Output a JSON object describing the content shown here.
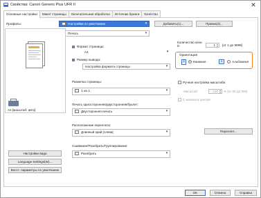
{
  "window": {
    "title": "Свойства: Canon Generic Plus UFR II",
    "close_glyph": "✕"
  },
  "tabs": [
    {
      "label": "Основные настройки"
    },
    {
      "label": "Макет страницы"
    },
    {
      "label": "Окончательная обработка"
    },
    {
      "label": "Источник бумаги"
    },
    {
      "label": "Качество"
    }
  ],
  "profile": {
    "label": "Профилы:",
    "value": "Настройки по умолчанию",
    "add_label": "Добавить(1)...",
    "edit_label": "Правка(2)..."
  },
  "output": {
    "label": "Способ вывода:",
    "value": "Печать"
  },
  "preview": {
    "caption": "A4 [масштаб: авто]"
  },
  "left_buttons": {
    "view_settings": "Настройки вида",
    "language": "Language Settings(W)...",
    "restore": "Восст. параметры по умолчанию"
  },
  "page_size": {
    "label": "Формат страницы:",
    "value": "A4"
  },
  "output_size": {
    "label": "Размер вывода:",
    "value": "Настройка формата страницы"
  },
  "copies": {
    "label": "Количество копи\nй:",
    "value": "1",
    "range": "[от 1 до 9999]"
  },
  "orientation": {
    "label": "Ориентация",
    "portrait_icon": "A",
    "portrait_label": "Книжная",
    "landscape_icon": "A",
    "landscape_label": "Альбомная"
  },
  "layout": {
    "label": "Разметка страницы:",
    "value": "1 на 1"
  },
  "manual_scale": {
    "label": "Ручная настройка масштаба",
    "scale_label": "Масштаб:",
    "scale_value": "100",
    "scale_range": "% [от 25 до 200]"
  },
  "center": {
    "label": "С начала в центре"
  },
  "duplex": {
    "label": "Печать односторонняя/двусторонняя/буклет:",
    "value": "Двусторонняя печать"
  },
  "binding": {
    "label": "Расположение переплета:",
    "value": "Длинный край [слева]",
    "button": "Переплет..."
  },
  "collate": {
    "label": "Сшивание/Разобрать/Группирование:",
    "value": "Разобрать"
  },
  "footer": {
    "ok": "OK",
    "cancel": "Отмена",
    "help": "Справка"
  }
}
